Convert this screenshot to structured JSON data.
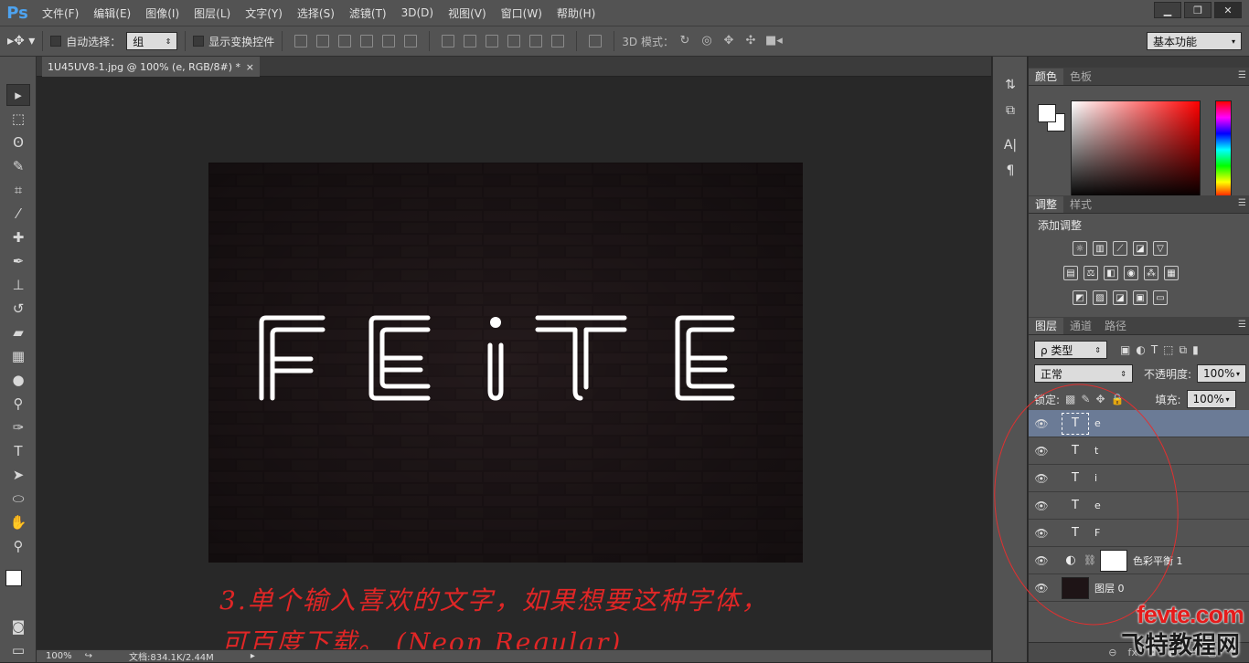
{
  "app": {
    "logo": "Ps"
  },
  "menu": [
    "文件(F)",
    "编辑(E)",
    "图像(I)",
    "图层(L)",
    "文字(Y)",
    "选择(S)",
    "滤镜(T)",
    "3D(D)",
    "视图(V)",
    "窗口(W)",
    "帮助(H)"
  ],
  "window_controls": {
    "minimize": "▁",
    "restore": "❐",
    "close": "✕"
  },
  "options": {
    "auto_select_label": "自动选择：",
    "auto_select_value": "组",
    "show_transform_label": "显示变换控件",
    "mode_3d_label": "3D 模式：",
    "workspace_value": "基本功能"
  },
  "document_tab": {
    "title": "1U45UV8-1.jpg @ 100% (e, RGB/8#) *",
    "close": "×"
  },
  "canvas_text": [
    "F",
    "E",
    "i",
    "T",
    "E"
  ],
  "status": {
    "zoom": "100%",
    "doc": "文档:834.1K/2.44M"
  },
  "annotation": {
    "line1": "3.单个输入喜欢的文字，如果想要这种字体，",
    "line2": "可百度下载。  (Neon Regular)"
  },
  "panels": {
    "color_tabs": [
      "颜色",
      "色板"
    ],
    "adj_tabs": [
      "调整",
      "样式"
    ],
    "adj_title": "添加调整",
    "layer_tabs": [
      "图层",
      "通道",
      "路径"
    ],
    "filter_value": "ρ 类型",
    "blend_value": "正常",
    "opacity_label": "不透明度:",
    "opacity_value": "100%",
    "lock_label": "锁定:",
    "fill_label": "填充:",
    "fill_value": "100%"
  },
  "layers": [
    {
      "name": "e",
      "type": "T",
      "selected": true
    },
    {
      "name": "t",
      "type": "T",
      "selected": false
    },
    {
      "name": "i",
      "type": "T",
      "selected": false
    },
    {
      "name": "e",
      "type": "T",
      "selected": false
    },
    {
      "name": "F",
      "type": "T",
      "selected": false
    },
    {
      "name": "色彩平衡 1",
      "type": "adj",
      "selected": false
    },
    {
      "name": "图层 0",
      "type": "img",
      "selected": false
    }
  ],
  "layers_bottom": [
    "⊖",
    "fx",
    "◘",
    "◐",
    "▭",
    "▢",
    "🗑"
  ],
  "watermark": {
    "top": "fevte.com",
    "bottom": "飞特教程网"
  },
  "colors": {
    "selection": "#6b7b96",
    "annotation": "#e02626",
    "watermark": "#e51b1b"
  }
}
